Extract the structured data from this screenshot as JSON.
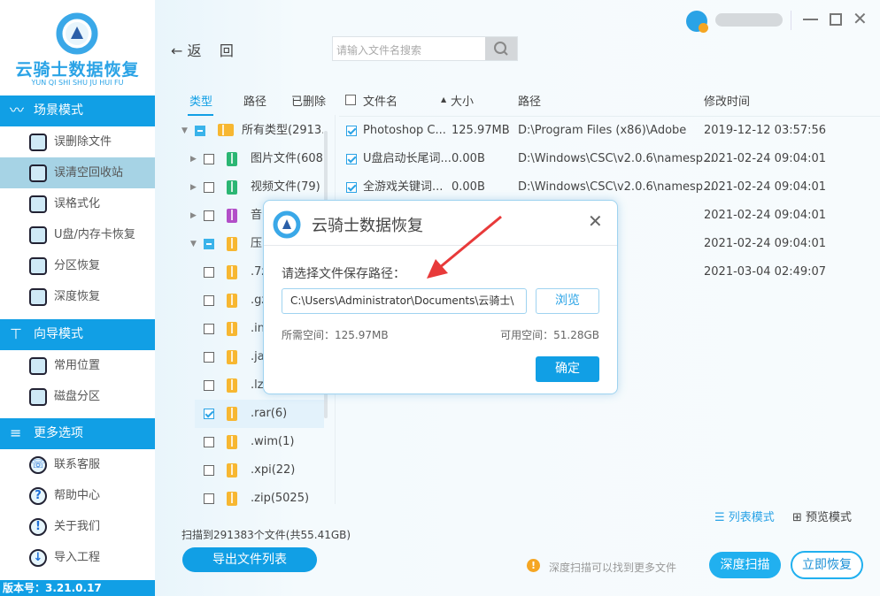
{
  "app": {
    "logo_title": "云骑士数据恢复",
    "logo_subtitle": "YUN QI SHI SHU JU HUI FU",
    "version": "版本号：3.21.0.17",
    "accent": "#119fe5"
  },
  "sidebar": {
    "sections": [
      {
        "label": "场景模式",
        "icon": "chart-monitor-icon",
        "items": [
          {
            "label": "误删除文件",
            "icon": "deleted-file-icon"
          },
          {
            "label": "误清空回收站",
            "icon": "recycle-bin-icon",
            "selected": true
          },
          {
            "label": "误格式化",
            "icon": "floppy-icon"
          },
          {
            "label": "U盘/内存卡恢复",
            "icon": "sd-card-icon"
          },
          {
            "label": "分区恢复",
            "icon": "partition-icon"
          },
          {
            "label": "深度恢复",
            "icon": "deep-recover-icon"
          }
        ]
      },
      {
        "label": "向导模式",
        "icon": "signpost-icon",
        "items": [
          {
            "label": "常用位置",
            "icon": "windows-monitor-icon"
          },
          {
            "label": "磁盘分区",
            "icon": "disk-icon"
          }
        ]
      },
      {
        "label": "更多选项",
        "icon": "menu-icon",
        "items": [
          {
            "label": "联系客服",
            "icon": "phone-icon"
          },
          {
            "label": "帮助中心",
            "icon": "help-icon"
          },
          {
            "label": "关于我们",
            "icon": "info-icon"
          },
          {
            "label": "导入工程",
            "icon": "import-icon"
          }
        ]
      }
    ]
  },
  "toolbar": {
    "back_label": "返",
    "back_label2": "回",
    "search_placeholder": "请输入文件名搜索"
  },
  "tree": {
    "tabs": [
      "类型",
      "路径",
      "已删除"
    ],
    "rows": [
      {
        "label": "所有类型(2913...",
        "state": "partial",
        "expand": "open",
        "icon": "folder"
      },
      {
        "label": "图片文件(608...",
        "state": "off",
        "expand": "closed",
        "icon": "image"
      },
      {
        "label": "视频文件(79)",
        "state": "off",
        "expand": "closed",
        "icon": "video"
      },
      {
        "label": "音",
        "state": "off",
        "expand": "closed",
        "icon": "music"
      },
      {
        "label": "压",
        "state": "partial",
        "expand": "open",
        "icon": "zip"
      },
      {
        "label": ".7z",
        "state": "off",
        "icon": "zip"
      },
      {
        "label": ".gz",
        "state": "off",
        "icon": "zip"
      },
      {
        "label": ".in",
        "state": "off",
        "icon": "zip"
      },
      {
        "label": ".ja",
        "state": "off",
        "icon": "zip"
      },
      {
        "label": ".lz",
        "state": "off",
        "icon": "zip"
      },
      {
        "label": ".rar(6)",
        "state": "on",
        "icon": "zip",
        "selected": true
      },
      {
        "label": ".wim(1)",
        "state": "off",
        "icon": "zip"
      },
      {
        "label": ".xpi(22)",
        "state": "off",
        "icon": "zip"
      },
      {
        "label": ".zip(5025)",
        "state": "off",
        "icon": "zip"
      }
    ]
  },
  "filelist": {
    "columns": [
      "文件名",
      "大小",
      "路径",
      "修改时间"
    ],
    "rows": [
      {
        "name": "Photoshop C...",
        "size": "125.97MB",
        "path": "D:\\Program Files (x86)\\Adobe",
        "time": "2019-12-12 03:57:56"
      },
      {
        "name": "U盘启动长尾词...",
        "size": "0.00B",
        "path": "D:\\Windows\\CSC\\v2.0.6\\namesp...",
        "time": "2021-02-24 09:04:01"
      },
      {
        "name": "全游戏关键词...",
        "size": "0.00B",
        "path": "D:\\Windows\\CSC\\v2.0.6\\namesp...",
        "time": "2021-02-24 09:04:01"
      },
      {
        "name": "",
        "size": "",
        "path": "2.0.6\\namesp...",
        "time": "2021-02-24 09:04:01"
      },
      {
        "name": "",
        "size": "",
        "path": "2.0.6\\namesp...",
        "time": "2021-02-24 09:04:01"
      },
      {
        "name": "",
        "size": "",
        "path": "2.0.6\\namesp...",
        "time": "2021-03-04 02:49:07"
      }
    ]
  },
  "footer": {
    "scan_summary": "扫描到291383个文件(共55.41GB)",
    "export_label": "导出文件列表",
    "list_mode": "列表模式",
    "preview_mode": "预览模式",
    "tip": "深度扫描可以找到更多文件",
    "deep_scan": "深度扫描",
    "recover_now": "立即恢复"
  },
  "dialog": {
    "title": "云骑士数据恢复",
    "prompt": "请选择文件保存路径：",
    "path_value": "C:\\Users\\Administrator\\Documents\\云骑士\\",
    "browse": "浏览",
    "required": "所需空间：125.97MB",
    "available": "可用空间：51.28GB",
    "confirm": "确定"
  }
}
